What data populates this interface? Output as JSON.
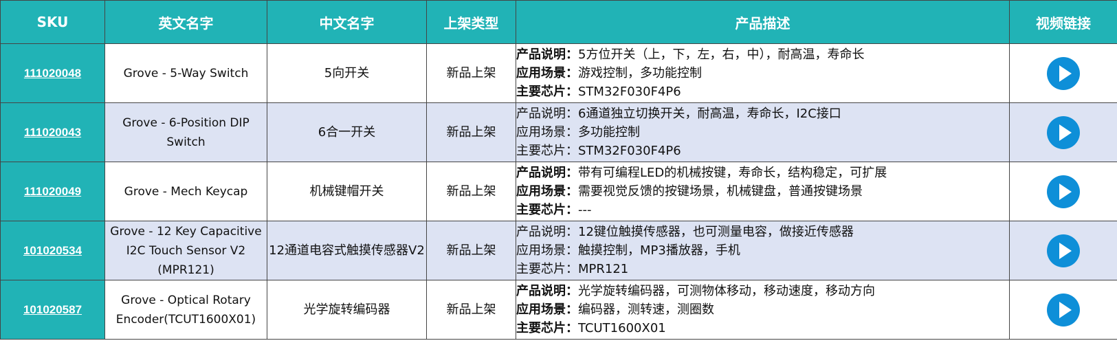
{
  "headers": {
    "sku": "SKU",
    "english_name": "英文名字",
    "chinese_name": "中文名字",
    "listing_type": "上架类型",
    "description": "产品描述",
    "video_link": "视频链接"
  },
  "rows": [
    {
      "sku": "111020048",
      "english_name": "Grove - 5-Way Switch",
      "chinese_name": "5向开关",
      "listing_type": "新品上架",
      "desc_bold": true,
      "description": [
        {
          "label": "产品说明：",
          "value": "5方位开关（上，下，左，右，中），耐高温，寿命长"
        },
        {
          "label": "应用场景：",
          "value": "游戏控制，多功能控制"
        },
        {
          "label": "主要芯片：",
          "value": "STM32F030F4P6"
        }
      ]
    },
    {
      "sku": "111020043",
      "english_name": "Grove - 6-Position DIP Switch",
      "chinese_name": "6合一开关",
      "listing_type": "新品上架",
      "desc_bold": false,
      "description": [
        {
          "label": "产品说明：",
          "value": "6通道独立切换开关，耐高温，寿命长，I2C接口"
        },
        {
          "label": "应用场景：",
          "value": "多功能控制"
        },
        {
          "label": "主要芯片：",
          "value": "STM32F030F4P6"
        }
      ]
    },
    {
      "sku": "111020049",
      "english_name": "Grove - Mech Keycap",
      "chinese_name": "机械键帽开关",
      "listing_type": "新品上架",
      "desc_bold": true,
      "description": [
        {
          "label": "产品说明：",
          "value": "带有可编程LED的机械按键，寿命长，结构稳定，可扩展"
        },
        {
          "label": "应用场景：",
          "value": "需要视觉反馈的按键场景，机械键盘，普通按键场景"
        },
        {
          "label": "主要芯片：",
          "value": "---"
        }
      ]
    },
    {
      "sku": "101020534",
      "english_name": "Grove - 12 Key Capacitive I2C Touch Sensor V2 (MPR121)",
      "chinese_name": "12通道电容式触摸传感器V2",
      "listing_type": "新品上架",
      "desc_bold": false,
      "description": [
        {
          "label": "产品说明：",
          "value": "12键位触摸传感器，也可测量电容，做接近传感器"
        },
        {
          "label": "应用场景：",
          "value": "触摸控制，MP3播放器，手机"
        },
        {
          "label": "主要芯片：",
          "value": "MPR121"
        }
      ]
    },
    {
      "sku": "101020587",
      "english_name": "Grove - Optical Rotary Encoder(TCUT1600X01)",
      "chinese_name": "光学旋转编码器",
      "listing_type": "新品上架",
      "desc_bold": true,
      "description": [
        {
          "label": "产品说明：",
          "value": "光学旋转编码器，可测物体移动，移动速度，移动方向"
        },
        {
          "label": "应用场景：",
          "value": "编码器，测转速，测圈数"
        },
        {
          "label": "主要芯片：",
          "value": "TCUT1600X01"
        }
      ]
    }
  ],
  "icons": {
    "video": "play-button-icon"
  },
  "colors": {
    "header_bg": "#21b3b6",
    "alt_row_bg": "#dde3f3",
    "play_icon": "#0e8fd8"
  }
}
